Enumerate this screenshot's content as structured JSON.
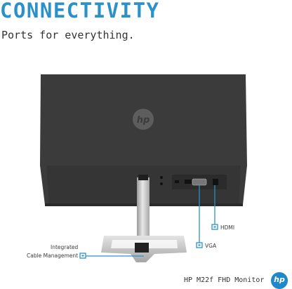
{
  "hero": {
    "headline": "CONNECTIVITY",
    "subhead": "Ports for everything."
  },
  "monitor_logo": "hp",
  "callouts": {
    "hdmi": "HDMI",
    "vga": "VGA",
    "cable_management_line1": "Integrated",
    "cable_management_line2": "Cable Management"
  },
  "footer": {
    "model": "HP M22f FHD Monitor",
    "brand_logo": "hp"
  },
  "colors": {
    "accent": "#2a91c9",
    "monitor_back": "#3b3b3b",
    "callout": "#2a91c9",
    "stand": "#c9c9c9"
  }
}
